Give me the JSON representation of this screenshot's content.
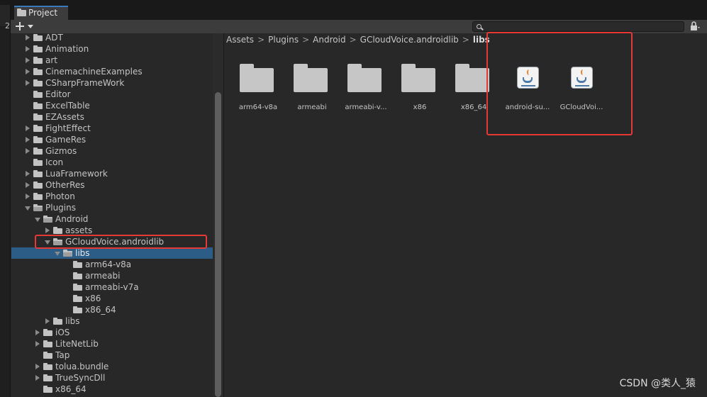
{
  "left_panel": {
    "label": "2"
  },
  "tab": {
    "label": "Project",
    "icon": "folder-icon"
  },
  "toolbar": {
    "add_icon": "plus-icon",
    "search_placeholder": "",
    "search_icon": "search-icon",
    "lock_icon": "lock-icon"
  },
  "tree": {
    "rows": [
      {
        "label": "ADT",
        "depth": 0,
        "arrow": "collapsed"
      },
      {
        "label": "Animation",
        "depth": 0,
        "arrow": "collapsed"
      },
      {
        "label": "art",
        "depth": 0,
        "arrow": "collapsed"
      },
      {
        "label": "CinemachineExamples",
        "depth": 0,
        "arrow": "collapsed"
      },
      {
        "label": "CSharpFrameWork",
        "depth": 0,
        "arrow": "collapsed"
      },
      {
        "label": "Editor",
        "depth": 0,
        "arrow": "none"
      },
      {
        "label": "ExcelTable",
        "depth": 0,
        "arrow": "none"
      },
      {
        "label": "EZAssets",
        "depth": 0,
        "arrow": "none"
      },
      {
        "label": "FightEffect",
        "depth": 0,
        "arrow": "collapsed"
      },
      {
        "label": "GameRes",
        "depth": 0,
        "arrow": "collapsed"
      },
      {
        "label": "Gizmos",
        "depth": 0,
        "arrow": "collapsed"
      },
      {
        "label": "Icon",
        "depth": 0,
        "arrow": "none"
      },
      {
        "label": "LuaFramework",
        "depth": 0,
        "arrow": "collapsed"
      },
      {
        "label": "OtherRes",
        "depth": 0,
        "arrow": "collapsed"
      },
      {
        "label": "Photon",
        "depth": 0,
        "arrow": "collapsed"
      },
      {
        "label": "Plugins",
        "depth": 0,
        "arrow": "expanded"
      },
      {
        "label": "Android",
        "depth": 1,
        "arrow": "expanded"
      },
      {
        "label": "assets",
        "depth": 2,
        "arrow": "collapsed"
      },
      {
        "label": "GCloudVoice.androidlib",
        "depth": 2,
        "arrow": "expanded"
      },
      {
        "label": "libs",
        "depth": 3,
        "arrow": "expanded",
        "selected": true
      },
      {
        "label": "arm64-v8a",
        "depth": 4,
        "arrow": "none"
      },
      {
        "label": "armeabi",
        "depth": 4,
        "arrow": "none"
      },
      {
        "label": "armeabi-v7a",
        "depth": 4,
        "arrow": "none"
      },
      {
        "label": "x86",
        "depth": 4,
        "arrow": "none"
      },
      {
        "label": "x86_64",
        "depth": 4,
        "arrow": "none"
      },
      {
        "label": "libs",
        "depth": 2,
        "arrow": "collapsed"
      },
      {
        "label": "iOS",
        "depth": 1,
        "arrow": "collapsed"
      },
      {
        "label": "LiteNetLib",
        "depth": 1,
        "arrow": "collapsed"
      },
      {
        "label": "Tap",
        "depth": 1,
        "arrow": "none"
      },
      {
        "label": "tolua.bundle",
        "depth": 1,
        "arrow": "collapsed"
      },
      {
        "label": "TrueSyncDll",
        "depth": 1,
        "arrow": "collapsed"
      },
      {
        "label": "x86_64",
        "depth": 1,
        "arrow": "none"
      }
    ]
  },
  "breadcrumbs": [
    "Assets",
    "Plugins",
    "Android",
    "GCloudVoice.androidlib",
    "libs"
  ],
  "breadcrumb_separator": ">",
  "assets": [
    {
      "label": "arm64-v8a",
      "icon": "folder-icon"
    },
    {
      "label": "armeabi",
      "icon": "folder-icon"
    },
    {
      "label": "armeabi-v...",
      "icon": "folder-icon"
    },
    {
      "label": "x86",
      "icon": "folder-icon"
    },
    {
      "label": "x86_64",
      "icon": "folder-icon"
    },
    {
      "label": "android-su...",
      "icon": "java-jar-icon"
    },
    {
      "label": "GCloudVoi...",
      "icon": "java-jar-icon"
    }
  ],
  "colors": {
    "selection": "#2c5d87",
    "highlight": "#e53935",
    "tab_accent": "#3a79bb"
  },
  "watermark": "CSDN @类人_猿"
}
